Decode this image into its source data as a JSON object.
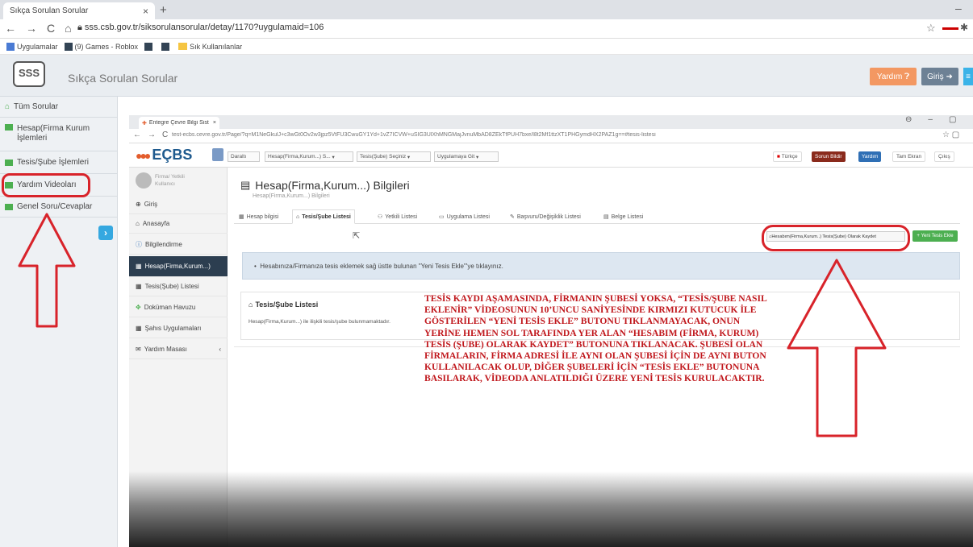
{
  "browser": {
    "tab_title": "Sıkça Sorulan Sorular",
    "tab_close": "×",
    "new_tab": "+",
    "window_min": "–",
    "url": "sss.csb.gov.tr/siksorulansorular/detay/1170?uygulamaid=106",
    "nav_icons": [
      "back-icon",
      "forward-icon",
      "reload-icon",
      "home-icon"
    ],
    "bookmarks": [
      "Uygulamalar",
      "(9) Games - Roblox",
      "Sık Kullanılanlar"
    ]
  },
  "site": {
    "logo_text": "SSS",
    "title": "Sıkça Sorulan Sorular",
    "help_button": "Yardım",
    "login_button": "Giriş",
    "sidebar": [
      {
        "label": "Tüm Sorular"
      },
      {
        "label": "Hesap(Firma Kurum İşlemleri"
      },
      {
        "label": "Tesis/Şube İşlemleri"
      },
      {
        "label": "Yardım Videoları"
      },
      {
        "label": "Genel Soru/Cevaplar"
      }
    ]
  },
  "video": {
    "inner_tab_title": "Entegre Çevre Bilgi Sist",
    "inner_url": "test-ecbs.cevre.gov.tr/Page/?q=M1NeGkulJ+c3wGt0Ov2w3jpz5VtFU3CwuGY1Yd+1vZ7ICVW+uSIG3UlXhMNGMajJvnuMbAD8ZEkTfPUH7bxe/l8t2Mf1ttzXT1PHGymdHX2PAZ1g==#tesis-listesi",
    "ecbs_logo": "EÇBS",
    "top_selects": [
      "Daraltı",
      "Hesap(Firma,Kurum...) S...",
      "Tesis(Şube) Seçiniz",
      "Uygulamaya Git"
    ],
    "top_buttons": [
      "Türkçe",
      "Sorun Bildir",
      "Yardım",
      "Tam Ekran",
      "Çıkış"
    ],
    "user_line1": "Firma/ Yetkili",
    "user_line2": "Kullanıcı",
    "menu": [
      {
        "label": "Giriş",
        "icon": "login-icon"
      },
      {
        "label": "Anasayfa",
        "icon": "home-icon"
      },
      {
        "label": "Bilgilendirme",
        "icon": "info-icon"
      },
      {
        "label": "Hesap(Firma,Kurum...)",
        "icon": "building-icon"
      },
      {
        "label": "Tesis(Şube) Listesi",
        "icon": "building-icon"
      },
      {
        "label": "Doküman Havuzu",
        "icon": "sitemap-icon"
      },
      {
        "label": "Şahıs Uygulamaları",
        "icon": "building-icon"
      },
      {
        "label": "Yardım Masası",
        "icon": "mail-icon"
      }
    ],
    "menu_caret": "‹",
    "page_title": "Hesap(Firma,Kurum...) Bilgileri",
    "page_subtitle": "Hesap(Firma,Kurum...) Bilgileri",
    "tabs": [
      "Hesap bilgisi",
      "Tesis/Şube Listesi",
      "Yetkili Listesi",
      "Uygulama Listesi",
      "Başvuru/Değişiklik Listesi",
      "Belge Listesi"
    ],
    "kaydet_button": "Hesabım(Firma,Kurum..) Tesis(Şube) Olarak Kaydet",
    "yeni_tesis_button": "Yeni Tesis Ekle",
    "info_text": "Hesabınıza/Firmanıza tesis eklemek sağ üstte bulunan \"Yeni Tesis Ekle\"'ye tıklayınız.",
    "list_title": "Tesis/Şube Listesi",
    "list_empty": "Hesap(Firma,Kurum...) ile ilişkili tesis/şube bulunmamaktadır."
  },
  "annotation": {
    "text": "TESİS KAYDI AŞAMASINDA, FİRMANIN ŞUBESİ YOKSA, “TESİS/ŞUBE NASIL EKLENİR” VİDEOSUNUN 10’UNCU SANİYESİNDE KIRMIZI KUTUCUK İLE GÖSTERİLEN “YENİ TESİS EKLE” BUTONU TIKLANMAYACAK, ONUN YERİNE HEMEN SOL TARAFINDA YER ALAN “HESABIM (FİRMA, KURUM) TESİS (ŞUBE) OLARAK KAYDET” BUTONUNA TIKLANACAK. ŞUBESİ OLAN FİRMALARIN, FİRMA ADRESİ İLE AYNI OLAN ŞUBESİ İÇİN DE AYNI BUTON KULLANILACAK OLUP, DİĞER ŞUBELERİ İÇİN “TESİS EKLE” BUTONUNA BASILARAK, VİDEODA ANLATILDIĞI ÜZERE YENİ TESİS KURULACAKTIR.",
    "color": "#c0171c"
  }
}
